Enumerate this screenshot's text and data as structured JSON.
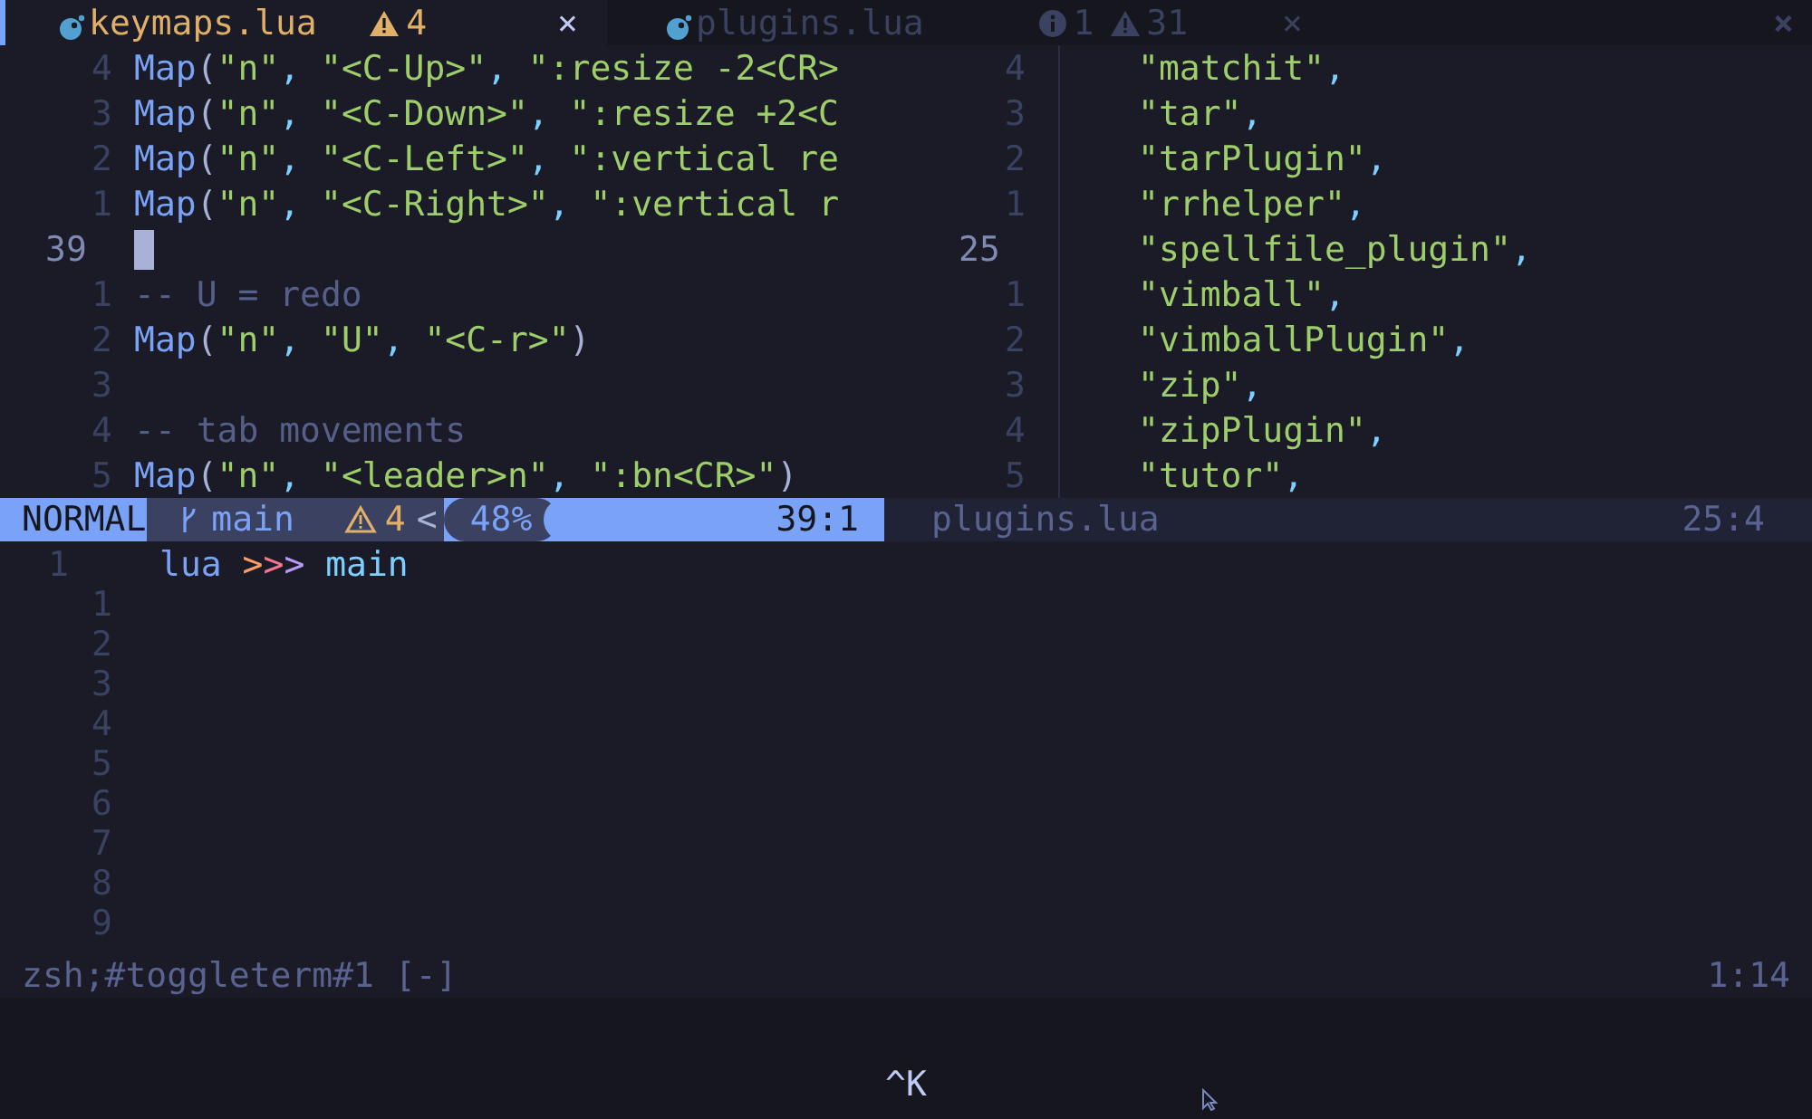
{
  "tabs": [
    {
      "label": "keymaps.lua",
      "selected": true,
      "warnings": "4",
      "close": "×"
    },
    {
      "label": "plugins.lua",
      "selected": false,
      "infos": "1",
      "warnings": "31",
      "close": "×"
    }
  ],
  "close_all": "×",
  "left_pane": {
    "lines": [
      {
        "number": "4",
        "current": false,
        "tokens": [
          {
            "kind": "fn",
            "text": "Map"
          },
          {
            "kind": "paren",
            "text": "("
          },
          {
            "kind": "str",
            "text": "\"n\""
          },
          {
            "kind": "comma",
            "text": ", "
          },
          {
            "kind": "str",
            "text": "\"<C-Up>\""
          },
          {
            "kind": "comma",
            "text": ", "
          },
          {
            "kind": "str",
            "text": "\":resize -2<CR>"
          }
        ]
      },
      {
        "number": "3",
        "current": false,
        "tokens": [
          {
            "kind": "fn",
            "text": "Map"
          },
          {
            "kind": "paren",
            "text": "("
          },
          {
            "kind": "str",
            "text": "\"n\""
          },
          {
            "kind": "comma",
            "text": ", "
          },
          {
            "kind": "str",
            "text": "\"<C-Down>\""
          },
          {
            "kind": "comma",
            "text": ", "
          },
          {
            "kind": "str",
            "text": "\":resize +2<C"
          }
        ]
      },
      {
        "number": "2",
        "current": false,
        "tokens": [
          {
            "kind": "fn",
            "text": "Map"
          },
          {
            "kind": "paren",
            "text": "("
          },
          {
            "kind": "str",
            "text": "\"n\""
          },
          {
            "kind": "comma",
            "text": ", "
          },
          {
            "kind": "str",
            "text": "\"<C-Left>\""
          },
          {
            "kind": "comma",
            "text": ", "
          },
          {
            "kind": "str",
            "text": "\":vertical re"
          }
        ]
      },
      {
        "number": "1",
        "current": false,
        "tokens": [
          {
            "kind": "fn",
            "text": "Map"
          },
          {
            "kind": "paren",
            "text": "("
          },
          {
            "kind": "str",
            "text": "\"n\""
          },
          {
            "kind": "comma",
            "text": ", "
          },
          {
            "kind": "str",
            "text": "\"<C-Right>\""
          },
          {
            "kind": "comma",
            "text": ", "
          },
          {
            "kind": "str",
            "text": "\":vertical r"
          }
        ]
      },
      {
        "number": "39",
        "current": true
      },
      {
        "number": "1",
        "current": false,
        "tokens": [
          {
            "kind": "comment",
            "text": "-- U = redo"
          }
        ]
      },
      {
        "number": "2",
        "current": false,
        "tokens": [
          {
            "kind": "fn",
            "text": "Map"
          },
          {
            "kind": "paren",
            "text": "("
          },
          {
            "kind": "str",
            "text": "\"n\""
          },
          {
            "kind": "comma",
            "text": ", "
          },
          {
            "kind": "str",
            "text": "\"U\""
          },
          {
            "kind": "comma",
            "text": ", "
          },
          {
            "kind": "str",
            "text": "\"<C-r>\""
          },
          {
            "kind": "paren",
            "text": ")"
          }
        ]
      },
      {
        "number": "3",
        "current": false
      },
      {
        "number": "4",
        "current": false,
        "tokens": [
          {
            "kind": "comment",
            "text": "-- tab movements"
          }
        ]
      },
      {
        "number": "5",
        "current": false,
        "tokens": [
          {
            "kind": "fn",
            "text": "Map"
          },
          {
            "kind": "paren",
            "text": "("
          },
          {
            "kind": "str",
            "text": "\"n\""
          },
          {
            "kind": "comma",
            "text": ", "
          },
          {
            "kind": "str",
            "text": "\"<leader>n\""
          },
          {
            "kind": "comma",
            "text": ", "
          },
          {
            "kind": "str",
            "text": "\":bn<CR>\""
          },
          {
            "kind": "paren",
            "text": ")"
          }
        ]
      }
    ]
  },
  "right_pane": {
    "lines": [
      {
        "number": "4",
        "current": false,
        "tokens": [
          {
            "kind": "str",
            "text": "\"matchit\""
          },
          {
            "kind": "comma",
            "text": ","
          }
        ]
      },
      {
        "number": "3",
        "current": false,
        "tokens": [
          {
            "kind": "str",
            "text": "\"tar\""
          },
          {
            "kind": "comma",
            "text": ","
          }
        ]
      },
      {
        "number": "2",
        "current": false,
        "tokens": [
          {
            "kind": "str",
            "text": "\"tarPlugin\""
          },
          {
            "kind": "comma",
            "text": ","
          }
        ]
      },
      {
        "number": "1",
        "current": false,
        "tokens": [
          {
            "kind": "str",
            "text": "\"rrhelper\""
          },
          {
            "kind": "comma",
            "text": ","
          }
        ]
      },
      {
        "number": "25",
        "current": true,
        "tokens": [
          {
            "kind": "str",
            "text": "\"spellfile_plugin\""
          },
          {
            "kind": "comma",
            "text": ","
          }
        ]
      },
      {
        "number": "1",
        "current": false,
        "tokens": [
          {
            "kind": "str",
            "text": "\"vimball\""
          },
          {
            "kind": "comma",
            "text": ","
          }
        ]
      },
      {
        "number": "2",
        "current": false,
        "tokens": [
          {
            "kind": "str",
            "text": "\"vimballPlugin\""
          },
          {
            "kind": "comma",
            "text": ","
          }
        ]
      },
      {
        "number": "3",
        "current": false,
        "tokens": [
          {
            "kind": "str",
            "text": "\"zip\""
          },
          {
            "kind": "comma",
            "text": ","
          }
        ]
      },
      {
        "number": "4",
        "current": false,
        "tokens": [
          {
            "kind": "str",
            "text": "\"zipPlugin\""
          },
          {
            "kind": "comma",
            "text": ","
          }
        ]
      },
      {
        "number": "5",
        "current": false,
        "tokens": [
          {
            "kind": "str",
            "text": "\"tutor\""
          },
          {
            "kind": "comma",
            "text": ","
          }
        ]
      }
    ]
  },
  "status_line": {
    "mode": "NORMAL",
    "branch": "main",
    "warnings": "4",
    "separator": "<",
    "progress": "48%",
    "position": "39:1"
  },
  "inactive_status": {
    "file": "plugins.lua",
    "position": "25:4"
  },
  "terminal": {
    "prompt_number": "1",
    "prompt": {
      "dir": "lua",
      "arrows": [
        ">",
        ">",
        ">"
      ],
      "branch": "main"
    },
    "line_numbers": [
      "1",
      "2",
      "3",
      "4",
      "5",
      "6",
      "7",
      "8",
      "9"
    ]
  },
  "terminal_status": {
    "title": "zsh;#toggleterm#1 [-]",
    "position": "1:14"
  },
  "command_line": {
    "keys": "^K"
  }
}
